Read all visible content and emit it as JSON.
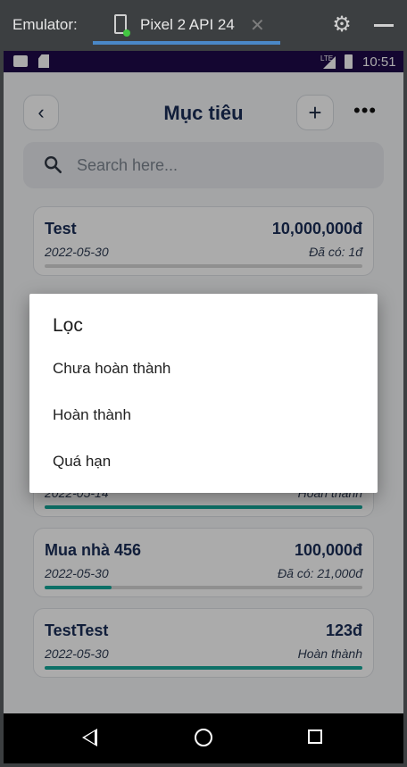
{
  "emulator": {
    "label": "Emulator:",
    "tab_title": "Pixel 2 API 24",
    "close_glyph": "✕",
    "settings_icon": "gear-icon",
    "minimize_icon": "minimize-icon"
  },
  "status_bar": {
    "network": "LTE",
    "time": "10:51"
  },
  "header": {
    "back_glyph": "‹",
    "title": "Mục tiêu",
    "add_glyph": "+",
    "more_glyph": "•••"
  },
  "search": {
    "placeholder": "Search here..."
  },
  "goals": [
    {
      "name": "Test",
      "amount": "10,000,000đ",
      "date": "2022-05-30",
      "status": "Đã có: 1đ",
      "progress": 0.0
    },
    {
      "name": "",
      "amount": "",
      "date": "2022-05-14",
      "status": "Hoàn thành",
      "progress": 1.0
    },
    {
      "name": "Mua nhà 456",
      "amount": "100,000đ",
      "date": "2022-05-30",
      "status": "Đã có: 21,000đ",
      "progress": 0.21
    },
    {
      "name": "TestTest",
      "amount": "123đ",
      "date": "2022-05-30",
      "status": "Hoàn thành",
      "progress": 1.0
    }
  ],
  "filter_dialog": {
    "title": "Lọc",
    "options": [
      "Chưa hoàn thành",
      "Hoàn thành",
      "Quá hạn"
    ]
  },
  "colors": {
    "accent": "#14a89a",
    "title": "#1a2d57",
    "status_bar": "#1e0a4a"
  }
}
